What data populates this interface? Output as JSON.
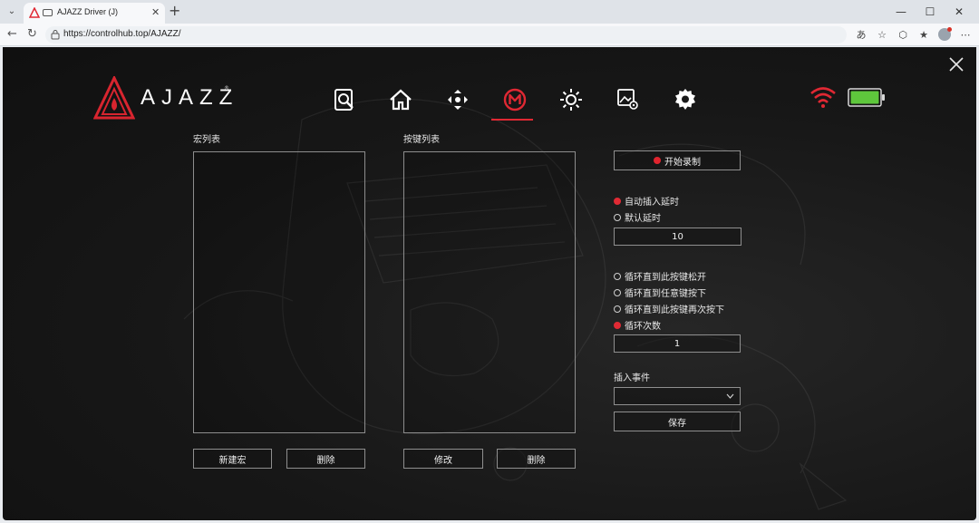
{
  "browser": {
    "tab_title": "AJAZZ Driver (J)",
    "url": "https://controlhub.top/AJAZZ/"
  },
  "app": {
    "brand": "AJAZZ",
    "brand_mark": "®",
    "nav": [
      "search-device-icon",
      "home-icon",
      "move-direction-icon",
      "macro-icon",
      "lighting-icon",
      "image-settings-icon",
      "settings-gear-icon"
    ],
    "active_nav": "macro-icon",
    "battery_color": "#5ec73c",
    "accent_color": "#e02833",
    "macro_list": {
      "label": "宏列表",
      "new_button": "新建宏",
      "delete_button": "删除"
    },
    "key_list": {
      "label": "按键列表",
      "edit_button": "修改",
      "delete_button": "删除"
    },
    "record_button": "开始录制",
    "delay_options": [
      {
        "label": "自动插入延时",
        "selected": true
      },
      {
        "label": "默认延时",
        "selected": false
      }
    ],
    "delay_value": "10",
    "loop_options": [
      {
        "label": "循环直到此按键松开",
        "selected": false
      },
      {
        "label": "循环直到任意键按下",
        "selected": false
      },
      {
        "label": "循环直到此按键再次按下",
        "selected": false
      },
      {
        "label": "循环次数",
        "selected": true
      }
    ],
    "loop_count": "1",
    "insert_event_label": "插入事件",
    "insert_event_value": "",
    "save_button": "保存"
  }
}
